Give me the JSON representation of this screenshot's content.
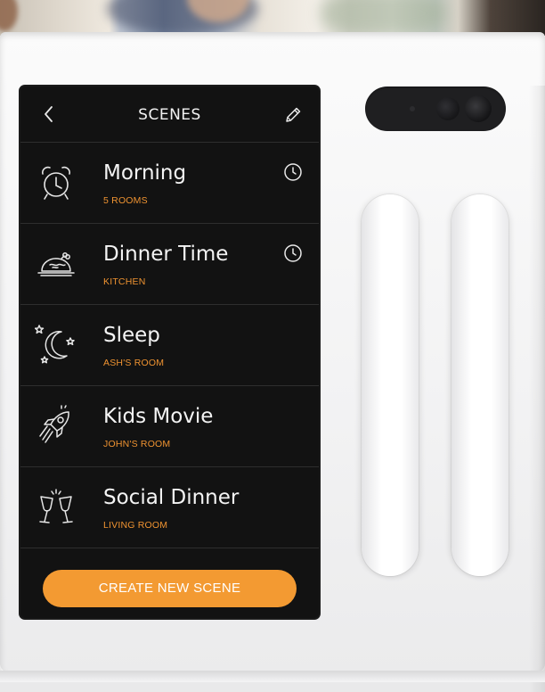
{
  "header": {
    "title": "SCENES"
  },
  "icons": {
    "back": "chevron-left-icon",
    "edit": "pencil-icon",
    "schedule": "clock-icon"
  },
  "scenes": [
    {
      "name": "Morning",
      "room": "5 ROOMS",
      "icon": "alarm-clock-icon",
      "scheduled": true
    },
    {
      "name": "Dinner Time",
      "room": "KITCHEN",
      "icon": "roast-dish-icon",
      "scheduled": true
    },
    {
      "name": "Sleep",
      "room": "ASH'S ROOM",
      "icon": "moon-stars-icon",
      "scheduled": false
    },
    {
      "name": "Kids Movie",
      "room": "JOHN'S ROOM",
      "icon": "rocket-icon",
      "scheduled": false
    },
    {
      "name": "Social Dinner",
      "room": "LIVING ROOM",
      "icon": "wine-glasses-icon",
      "scheduled": false
    }
  ],
  "cta": {
    "label": "CREATE NEW SCENE"
  },
  "colors": {
    "accent": "#f39a32",
    "room_text": "#ef9331",
    "screen_bg": "#121212"
  }
}
